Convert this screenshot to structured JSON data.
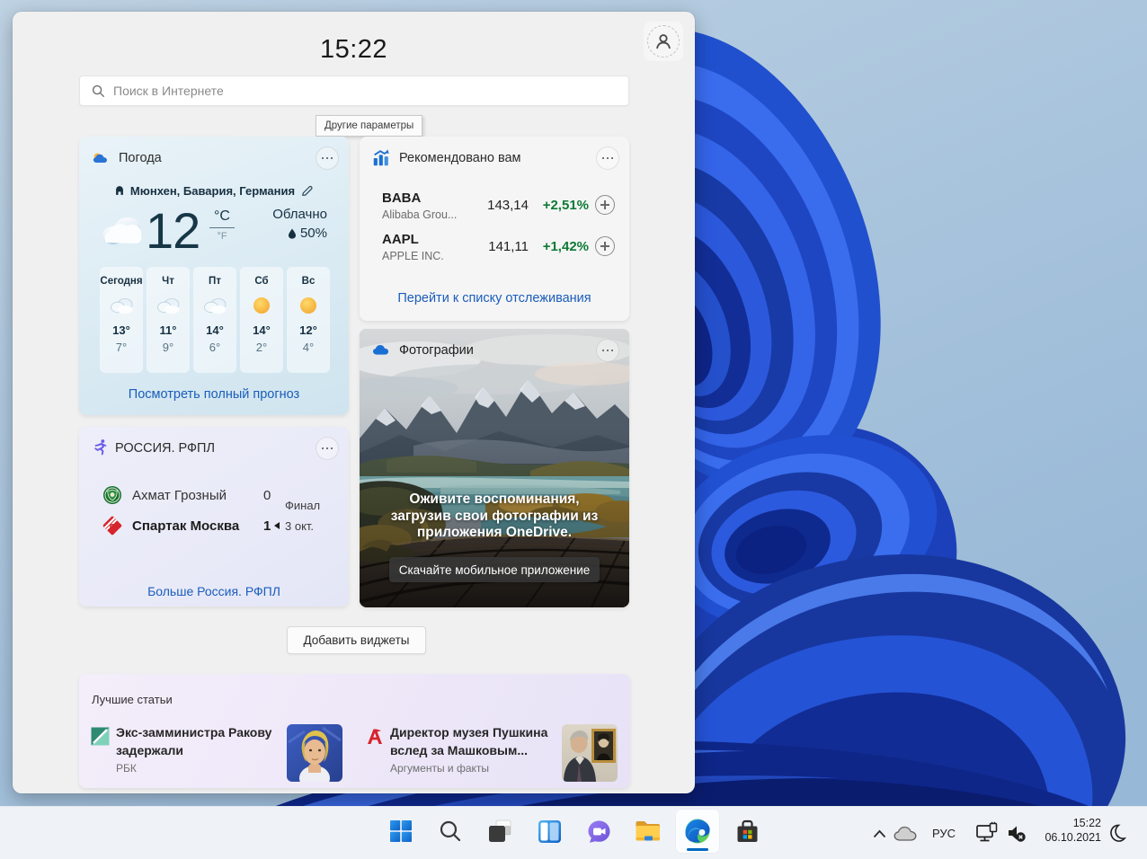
{
  "panel": {
    "time": "15:22"
  },
  "search": {
    "placeholder": "Поиск в Интернете"
  },
  "tooltip": {
    "text": "Другие параметры"
  },
  "weather": {
    "title": "Погода",
    "location": "Мюнхен, Бавария, Германия",
    "temp": "12",
    "unit_c": "°C",
    "unit_f": "°F",
    "condition": "Облачно",
    "precipitation": "50%",
    "forecast": [
      {
        "day": "Сегодня",
        "hi": "13°",
        "lo": "7°",
        "icon": "cloudy"
      },
      {
        "day": "Чт",
        "hi": "11°",
        "lo": "9°",
        "icon": "cloudy"
      },
      {
        "day": "Пт",
        "hi": "14°",
        "lo": "6°",
        "icon": "cloudy"
      },
      {
        "day": "Сб",
        "hi": "14°",
        "lo": "2°",
        "icon": "sunny"
      },
      {
        "day": "Вс",
        "hi": "12°",
        "lo": "4°",
        "icon": "sunny"
      }
    ],
    "link": "Посмотреть полный прогноз"
  },
  "stocks": {
    "title": "Рекомендовано вам",
    "rows": [
      {
        "ticker": "BABA",
        "name": "Alibaba Grou...",
        "price": "143,14",
        "change": "+2,51%"
      },
      {
        "ticker": "AAPL",
        "name": "APPLE INC.",
        "price": "141,11",
        "change": "+1,42%"
      }
    ],
    "link": "Перейти к списку отслеживания",
    "up_color": "#0e7a35"
  },
  "photos": {
    "title": "Фотографии",
    "message_line1": "Оживите воспоминания,",
    "message_line2": "загрузив свои фотографии из",
    "message_line3": "приложения OneDrive.",
    "button": "Скачайте мобильное приложение"
  },
  "sports": {
    "title": "РОССИЯ. РФПЛ",
    "rows": [
      {
        "team": "Ахмат Грозный",
        "score": "0"
      },
      {
        "team": "Спартак Москва",
        "score": "1"
      }
    ],
    "status": "Финал",
    "date": "3 окт.",
    "link": "Больше Россия. РФПЛ"
  },
  "add_widgets": {
    "label": "Добавить виджеты"
  },
  "news": {
    "title": "Лучшие статьи",
    "articles": [
      {
        "title": "Экс-замминистра Ракову задержали",
        "source": "РБК"
      },
      {
        "title": "Директор музея Пушкина вслед за Машковым...",
        "source": "Аргументы и факты"
      }
    ]
  },
  "taskbar": {
    "language": "РУС",
    "time": "15:22",
    "date": "06.10.2021"
  }
}
